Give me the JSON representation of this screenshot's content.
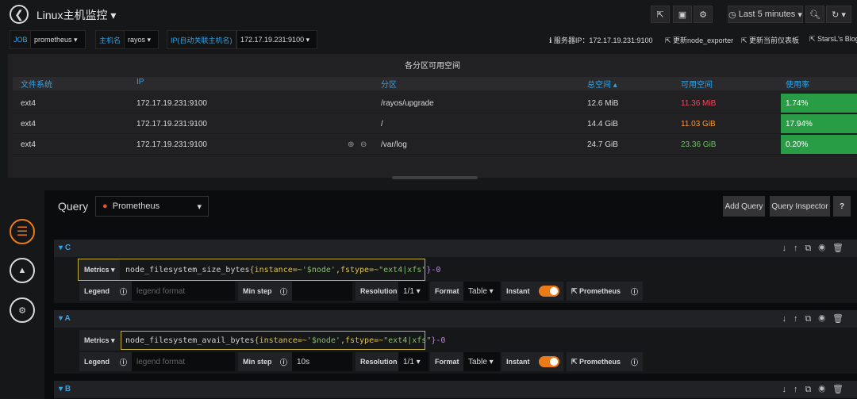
{
  "header": {
    "title": "Linux主机监控",
    "time_range": "Last 5 minutes"
  },
  "variables": [
    {
      "label": "JOB",
      "value": "prometheus"
    },
    {
      "label": "主机名",
      "value": "rayos"
    },
    {
      "label": "IP(自动关联主机名)",
      "value": "172.17.19.231:9100"
    }
  ],
  "links": {
    "server_ip": "服务器IP：172.17.19.231:9100",
    "update_exporter": "更新node_exporter",
    "update_dashboard": "更新当前仪表板",
    "blog": "StarsL's Blog"
  },
  "table_panel": {
    "title": "各分区可用空间",
    "columns": [
      "文件系统",
      "IP",
      "分区",
      "总空间 ▴",
      "可用空间",
      "使用率"
    ],
    "rows": [
      {
        "fs": "ext4",
        "ip": "172.17.19.231:9100",
        "mount": "/rayos/upgrade",
        "total": "12.6 MiB",
        "avail": "11.36 MiB",
        "usage": "1.74%"
      },
      {
        "fs": "ext4",
        "ip": "172.17.19.231:9100",
        "mount": "/",
        "total": "14.4 GiB",
        "avail": "11.03 GiB",
        "usage": "17.94%"
      },
      {
        "fs": "ext4",
        "ip": "172.17.19.231:9100",
        "mount": "/var/log",
        "total": "24.7 GiB",
        "avail": "23.36 GiB",
        "usage": "0.20%"
      }
    ]
  },
  "query_editor": {
    "label": "Query",
    "datasource": "Prometheus",
    "add_query": "Add Query",
    "query_inspector": "Query Inspector",
    "help": "?",
    "queries": [
      {
        "letter": "C",
        "metrics_label": "Metrics ▾",
        "expr_metric": "node_filesystem_size_bytes",
        "expr_open": "{instance=~",
        "expr_node": "'$node'",
        "expr_mid": ",fstype=~",
        "expr_fs": "\"ext4|xfs\"",
        "expr_close": "}-0",
        "legend_label": "Legend",
        "legend_placeholder": "legend format",
        "min_step_label": "Min step",
        "min_step_value": "",
        "resolution_label": "Resolution",
        "resolution_value": "1/1 ▾",
        "format_label": "Format",
        "format_value": "Table ▾",
        "instant_label": "Instant",
        "prom_link": "Prometheus"
      },
      {
        "letter": "A",
        "metrics_label": "Metrics ▾",
        "expr_metric": "node_filesystem_avail_bytes ",
        "expr_open": "{instance=~",
        "expr_node": "'$node'",
        "expr_mid": ",fstype=~",
        "expr_fs": "\"ext4|xfs\"",
        "expr_close": "}-0",
        "legend_label": "Legend",
        "legend_placeholder": "legend format",
        "min_step_label": "Min step",
        "min_step_value": "10s",
        "resolution_label": "Resolution",
        "resolution_value": "1/1 ▾",
        "format_label": "Format",
        "format_value": "Table ▾",
        "instant_label": "Instant",
        "prom_link": "Prometheus"
      },
      {
        "letter": "B"
      }
    ]
  },
  "colors": {
    "accent": "#33a2e5",
    "usage_green": "#299c46",
    "avail_red": "#f2495c",
    "avail_orange": "#ff9830",
    "avail_green": "#73bf69",
    "toggle_orange": "#eb7b18"
  }
}
